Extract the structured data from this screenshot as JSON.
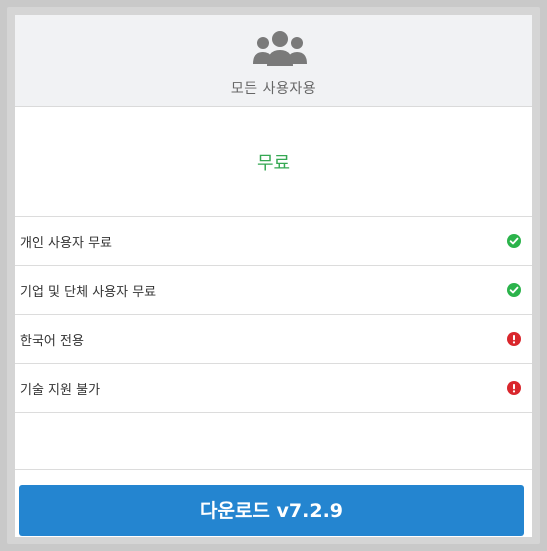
{
  "header": {
    "icon": "users-icon",
    "title": "모든 사용자용"
  },
  "plan": {
    "price_label": "무료",
    "price_color": "#35a853"
  },
  "features": [
    {
      "label": "개인 사용자 무료",
      "status": "check-icon",
      "status_color": "#2bb34b"
    },
    {
      "label": "기업 및 단체 사용자 무료",
      "status": "check-icon",
      "status_color": "#2bb34b"
    },
    {
      "label": "한국어 전용",
      "status": "alert-icon",
      "status_color": "#d9262c"
    },
    {
      "label": "기술 지원 불가",
      "status": "alert-icon",
      "status_color": "#d9262c"
    }
  ],
  "download": {
    "label": "다운로드 v7.2.9",
    "color": "#2485d0"
  }
}
